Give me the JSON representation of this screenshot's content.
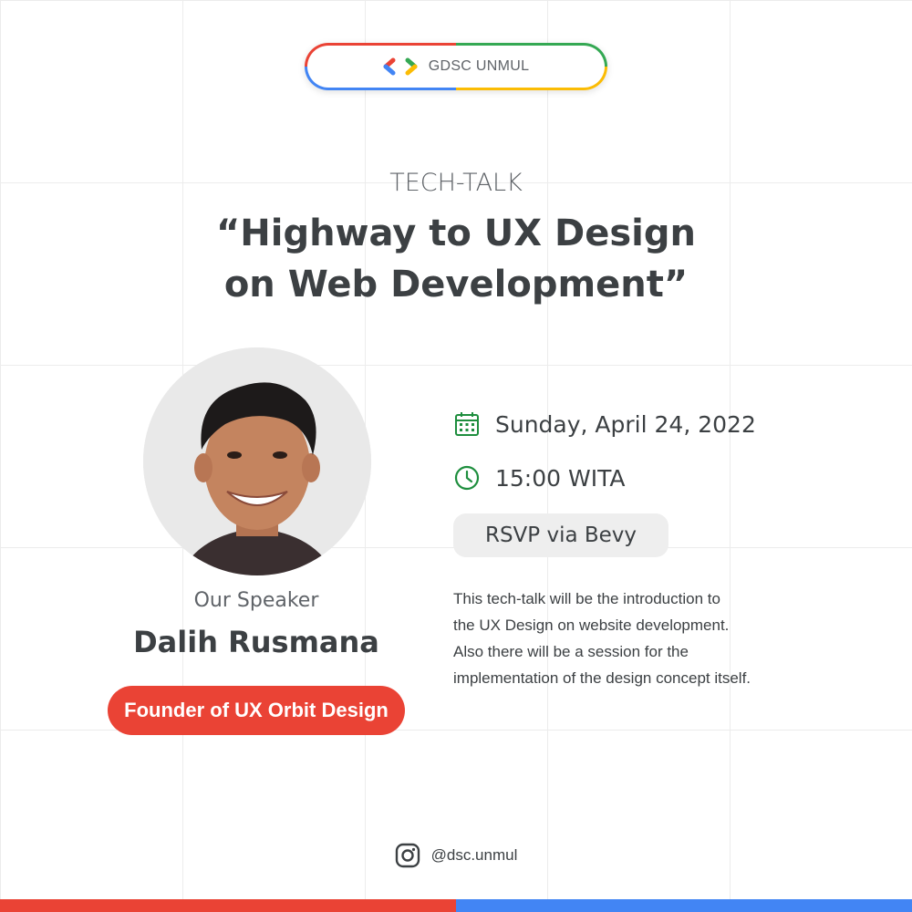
{
  "brand": {
    "logo_text": "GDSC UNMUL",
    "logo_icon": "gdsc-brackets-icon"
  },
  "event": {
    "type": "TECH-TALK",
    "title_line1": "“Highway to UX Design",
    "title_line2": "on Web Development”"
  },
  "speaker": {
    "caption": "Our Speaker",
    "name": "Dalih Rusmana",
    "role": "Founder of UX Orbit Design"
  },
  "details": {
    "date": "Sunday, April 24, 2022",
    "time": "15:00 WITA",
    "rsvp": "RSVP via Bevy",
    "description": [
      "This tech-talk will be the introduction to",
      "the UX Design on website development.",
      "Also there will be a session for the",
      "implementation of the design concept itself."
    ]
  },
  "social": {
    "icon": "instagram-icon",
    "handle": "@dsc.unmul"
  },
  "colors": {
    "red": "#ea4335",
    "blue": "#4285f4",
    "green": "#34a853",
    "yellow": "#fbbc04",
    "icon_green": "#1e8e3e",
    "text_dark": "#3c4043",
    "text_muted": "#5f6368"
  }
}
